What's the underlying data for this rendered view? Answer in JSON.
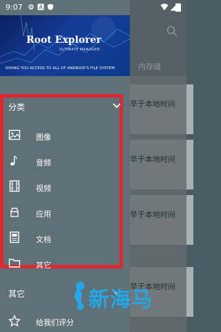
{
  "status_bar": {
    "time": "9:07"
  },
  "background_app": {
    "tab_label": "内存储",
    "card_text": "早于本地时间"
  },
  "drawer": {
    "header": {
      "logo_text": "Root Explorer",
      "logo_subtitle": "ULTIMATE MANAGER",
      "tagline": "GIVING YOU ACCESS TO ALL OF ANDROID'S FILE SYSTEM"
    },
    "categories": {
      "title": "分类",
      "items": [
        {
          "label": "图像",
          "icon": "image-icon"
        },
        {
          "label": "音频",
          "icon": "music-note-icon"
        },
        {
          "label": "视频",
          "icon": "film-icon"
        },
        {
          "label": "应用",
          "icon": "android-app-icon"
        },
        {
          "label": "文档",
          "icon": "document-icon"
        },
        {
          "label": "其它",
          "icon": "folder-icon"
        }
      ]
    },
    "other": {
      "title": "其它",
      "items": [
        {
          "label": "给我们评分",
          "icon": "star-icon"
        }
      ]
    }
  },
  "watermark": {
    "text": "新海马"
  },
  "colors": {
    "drawer_bg": "#5f7077",
    "highlight_border": "#e0262f",
    "watermark": "#21a8e8"
  }
}
